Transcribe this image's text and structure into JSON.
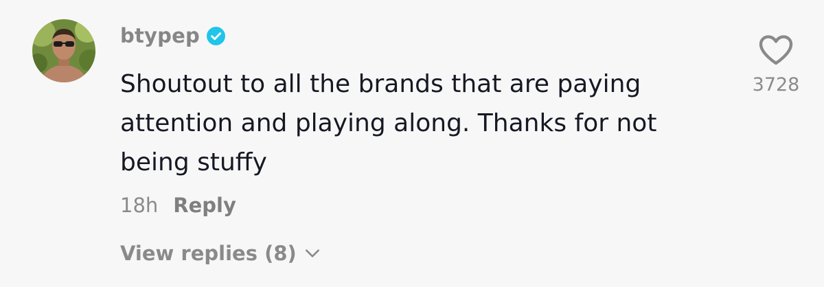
{
  "comment": {
    "username": "btypep",
    "verified": true,
    "text": "Shoutout to all the brands that are paying attention and playing along. Thanks for not being stuffy",
    "time": "18h",
    "reply_label": "Reply",
    "view_replies_label": "View replies (8)",
    "like_count": "3728"
  },
  "icons": {
    "verified": "verified-badge-icon",
    "heart": "heart-outline-icon",
    "chevron": "chevron-down-icon"
  },
  "colors": {
    "background": "#f7f7f7",
    "verified_badge": "#20c5e8",
    "text_primary": "#161823",
    "text_secondary": "#8a8a8a"
  }
}
